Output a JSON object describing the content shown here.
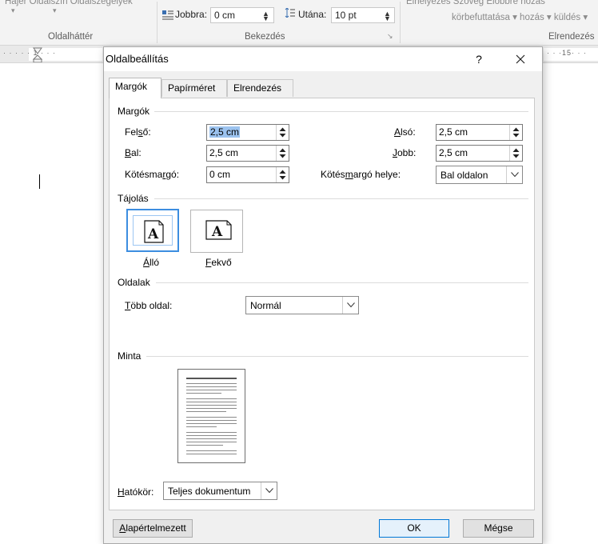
{
  "ribbon": {
    "top_left_text": "Hajer  Oldalszín  Oldalszegélyek",
    "group_oldalhatter": "Oldalháttér",
    "jobbra_label": "Jobbra:",
    "jobbra_value": "0 cm",
    "utana_label": "Utána:",
    "utana_value": "10 pt",
    "group_bekezdes": "Bekezdés",
    "arrange_top": "Elhelyezés    Szöveg    Előbbre hozás",
    "arrange_mid": "körbefuttatása ▾ hozás ▾ küldés ▾",
    "group_elrendezes": "Elrendezés",
    "ruler_left": "· · ·  · · 1 · · ·",
    "ruler_right": "· · ·15· · ·"
  },
  "dialog": {
    "title": "Oldalbeállítás",
    "help": "?",
    "tabs": [
      "Margók",
      "Papírméret",
      "Elrendezés"
    ],
    "margins": {
      "section": "Margók",
      "top_label_pre": "Fel",
      "top_label_acc": "s",
      "top_label_post": "ő:",
      "top_value": "2,5 cm",
      "bottom_label_acc": "A",
      "bottom_label_post": "lsó:",
      "bottom_value": "2,5 cm",
      "left_label_acc": "B",
      "left_label_post": "al:",
      "left_value": "2,5 cm",
      "right_label_acc": "J",
      "right_label_post": "obb:",
      "right_value": "2,5 cm",
      "gutter_label_pre": "Kötésma",
      "gutter_label_acc": "r",
      "gutter_label_post": "gó:",
      "gutter_value": "0 cm",
      "gutter_pos_label_pre": "Kötés",
      "gutter_pos_label_acc": "m",
      "gutter_pos_label_post": "argó helye:",
      "gutter_pos_value": "Bal oldalon"
    },
    "orientation": {
      "section": "Tájolás",
      "portrait_acc": "Á",
      "portrait_post": "lló",
      "landscape_acc": "F",
      "landscape_post": "ekvő",
      "glyph": "A"
    },
    "pages": {
      "section": "Oldalak",
      "multiple_label_acc": "T",
      "multiple_label_post": "öbb oldal:",
      "multiple_value": "Normál"
    },
    "preview": {
      "section": "Minta"
    },
    "apply": {
      "label_acc": "H",
      "label_post": "atókör:",
      "value": "Teljes dokumentum"
    },
    "buttons": {
      "default_acc": "A",
      "default_post": "lapértelmezett",
      "ok": "OK",
      "cancel": "Mégse"
    }
  }
}
